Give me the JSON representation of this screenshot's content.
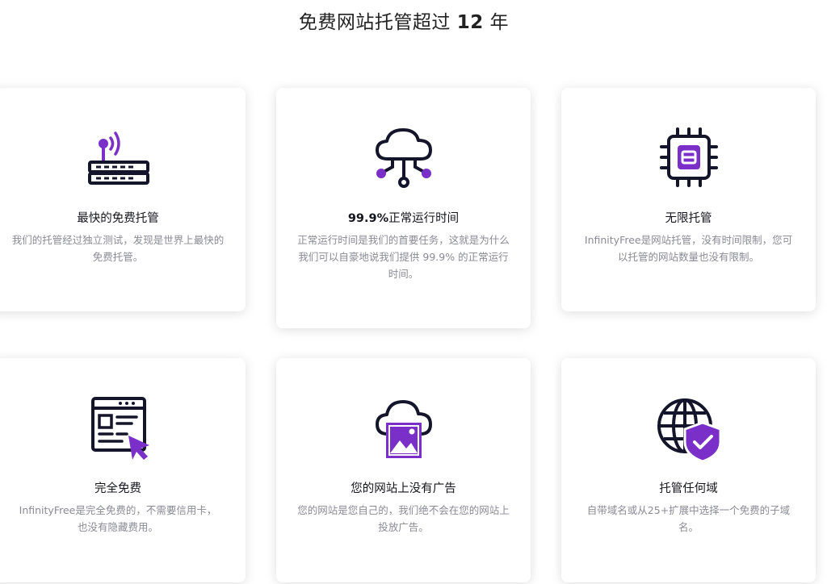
{
  "header": {
    "title_prefix": "免费网站托管超过 ",
    "title_number": "12",
    "title_suffix": " 年"
  },
  "features": [
    {
      "title": "最快的免费托管",
      "desc": "我们的托管经过独立测试，发现是世界上最快的免费托管。",
      "icon": "router-icon"
    },
    {
      "title_bold": "99.9%",
      "title": "正常运行时间",
      "desc": "正常运行时间是我们的首要任务，这就是为什么我们可以自豪地说我们提供 99.9% 的正常运行时间。",
      "icon": "cloud-network-icon"
    },
    {
      "title": "无限托管",
      "desc": "InfinityFree是网站托管，没有时间限制，您可以托管的网站数量也没有限制。",
      "icon": "cpu-chip-icon"
    },
    {
      "title": "完全免费",
      "desc": "InfinityFree是完全免费的，不需要信用卡，也没有隐藏费用。",
      "icon": "browser-cursor-icon"
    },
    {
      "title": "您的网站上没有广告",
      "desc": "您的网站是您自己的，我们绝不会在您的网站上投放广告。",
      "icon": "cloud-image-icon"
    },
    {
      "title": "托管任何域",
      "desc": "自带域名或从25+扩展中选择一个免费的子域名。",
      "icon": "globe-shield-icon"
    }
  ],
  "colors": {
    "accent": "#7b2fc9",
    "dark": "#14142b"
  }
}
